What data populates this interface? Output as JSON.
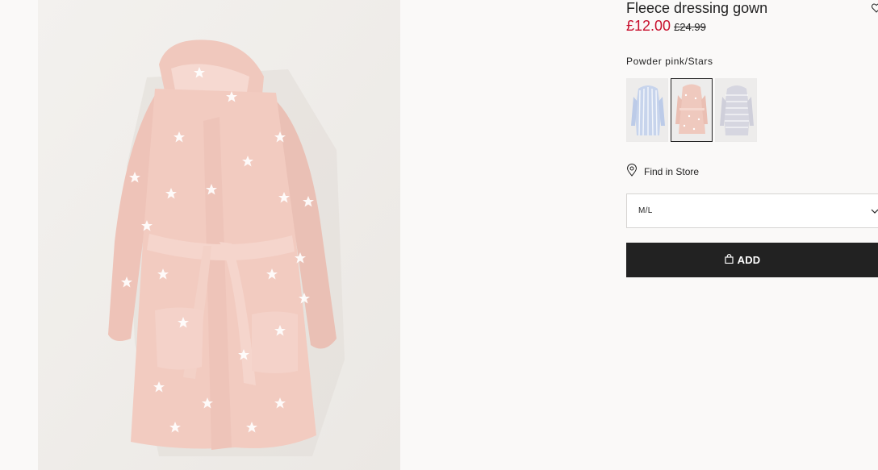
{
  "product": {
    "title": "Fleece dressing gown",
    "price_sale": "£12.00",
    "price_original": "£24.99",
    "price_color": "#c8102e",
    "image_icon": "dressing-gown-image",
    "favourite_icon": "heart-icon"
  },
  "colour": {
    "selected_label": "Powder pink/Stars",
    "swatches": [
      {
        "name": "blue-stripe",
        "color": "#b8c8e6",
        "selected": false
      },
      {
        "name": "powder-pink-stars",
        "color": "#ecc9c2",
        "selected": true
      },
      {
        "name": "grey-stripe",
        "color": "#c9c9d6",
        "selected": false
      }
    ]
  },
  "store": {
    "find_label": "Find in Store",
    "icon": "location-pin-icon"
  },
  "size": {
    "selected": "M/L",
    "icon": "chevron-down-icon"
  },
  "cart": {
    "add_label": "ADD",
    "icon": "shopping-bag-icon",
    "button_color": "#222222"
  }
}
